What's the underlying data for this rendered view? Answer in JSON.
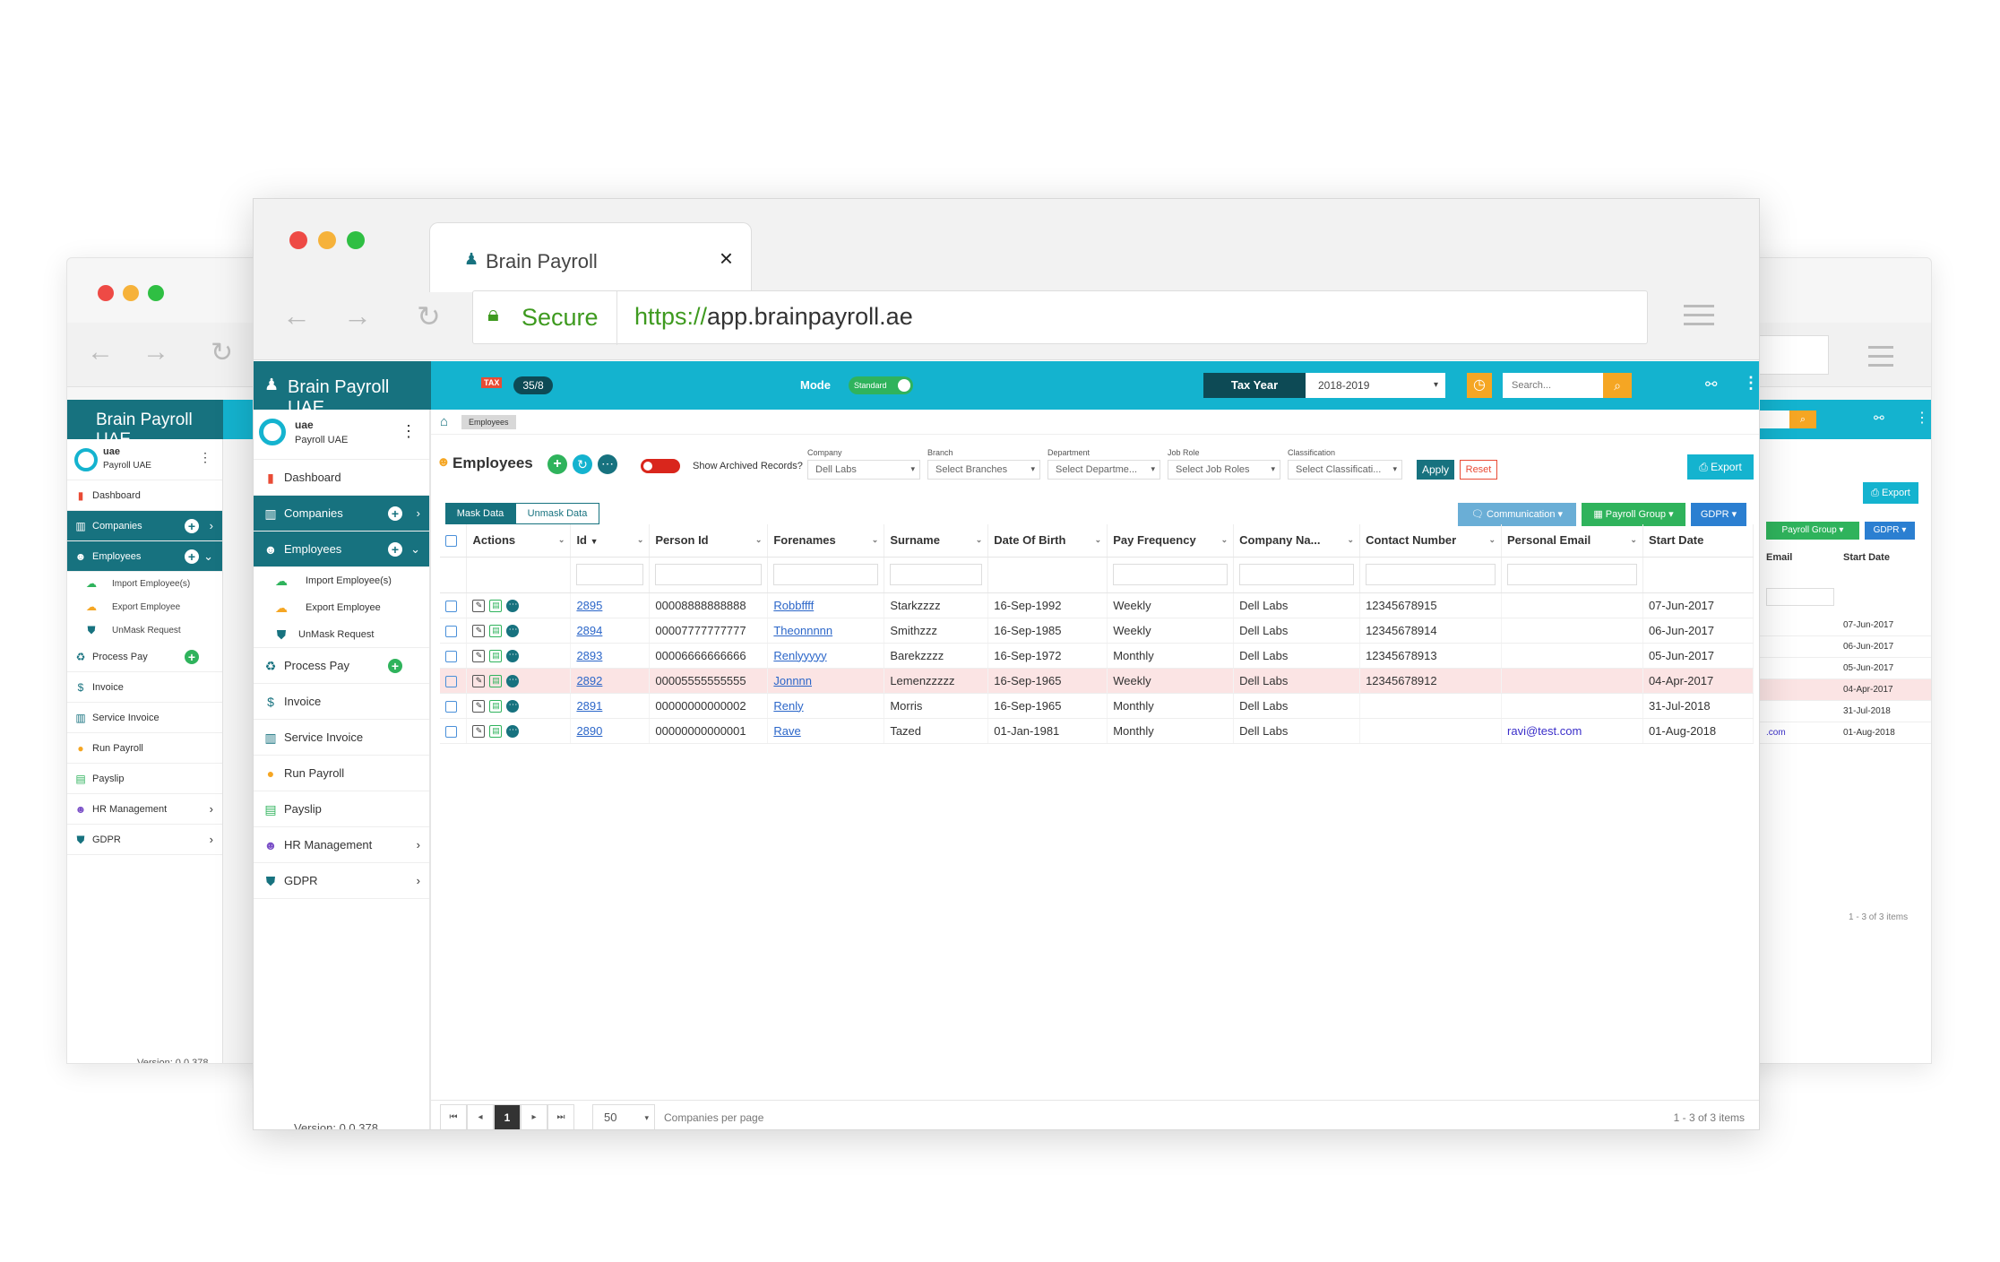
{
  "browser": {
    "tab_title": "Brain Payroll",
    "close_glyph": "×",
    "secure_label": "Secure",
    "url_scheme": "https://",
    "url_rest": "app.brainpayroll.ae"
  },
  "app": {
    "brand": "Brain Payroll UAE",
    "tax_badge": "TAX",
    "count_badge": "35/8",
    "mode_label": "Mode",
    "mode_toggle": "Standard",
    "tax_year_label": "Tax Year",
    "tax_year_value": "2018-2019",
    "search_placeholder": "Search..."
  },
  "user": {
    "name": "uae",
    "org": "Payroll UAE"
  },
  "sidebar": {
    "items": [
      {
        "label": "Dashboard"
      },
      {
        "label": "Companies"
      },
      {
        "label": "Employees"
      },
      {
        "label": "Import Employee(s)"
      },
      {
        "label": "Export Employee"
      },
      {
        "label": "UnMask Request"
      },
      {
        "label": "Process Pay"
      },
      {
        "label": "Invoice"
      },
      {
        "label": "Service Invoice"
      },
      {
        "label": "Run Payroll"
      },
      {
        "label": "Payslip"
      },
      {
        "label": "HR Management"
      },
      {
        "label": "GDPR"
      }
    ],
    "version": "Version: 0.0.378"
  },
  "page": {
    "breadcrumb": "Employees",
    "title": "Employees",
    "archived_label": "Show Archived Records?",
    "filters": [
      {
        "label": "Company",
        "value": "Dell Labs"
      },
      {
        "label": "Branch",
        "value": "Select Branches"
      },
      {
        "label": "Department",
        "value": "Select Departme..."
      },
      {
        "label": "Job Role",
        "value": "Select Job Roles"
      },
      {
        "label": "Classification",
        "value": "Select Classificati..."
      }
    ],
    "apply": "Apply",
    "reset": "Reset",
    "export": "Export",
    "mask": "Mask Data",
    "unmask": "Unmask Data",
    "communication": "Communication",
    "payroll_group": "Payroll Group",
    "gdpr": "GDPR"
  },
  "table": {
    "columns": [
      "Actions",
      "Id",
      "Person Id",
      "Forenames",
      "Surname",
      "Date Of Birth",
      "Pay Frequency",
      "Company Na...",
      "Contact Number",
      "Personal Email",
      "Start Date"
    ],
    "rows": [
      {
        "id": "2895",
        "person": "00008888888888",
        "fore": "Robbffff",
        "sur": "Starkzzzz",
        "dob": "16-Sep-1992",
        "freq": "Weekly",
        "comp": "Dell Labs",
        "phone": "12345678915",
        "email": "",
        "start": "07-Jun-2017"
      },
      {
        "id": "2894",
        "person": "00007777777777",
        "fore": "Theonnnnn",
        "sur": "Smithzzz",
        "dob": "16-Sep-1985",
        "freq": "Weekly",
        "comp": "Dell Labs",
        "phone": "12345678914",
        "email": "",
        "start": "06-Jun-2017"
      },
      {
        "id": "2893",
        "person": "00006666666666",
        "fore": "Renlyyyyy",
        "sur": "Barekzzzz",
        "dob": "16-Sep-1972",
        "freq": "Monthly",
        "comp": "Dell Labs",
        "phone": "12345678913",
        "email": "",
        "start": "05-Jun-2017"
      },
      {
        "id": "2892",
        "person": "00005555555555",
        "fore": "Jonnnn",
        "sur": "Lemenzzzzz",
        "dob": "16-Sep-1965",
        "freq": "Weekly",
        "comp": "Dell Labs",
        "phone": "12345678912",
        "email": "",
        "start": "04-Apr-2017"
      },
      {
        "id": "2891",
        "person": "00000000000002",
        "fore": "Renly",
        "sur": "Morris",
        "dob": "16-Sep-1965",
        "freq": "Monthly",
        "comp": "Dell Labs",
        "phone": "",
        "email": "",
        "start": "31-Jul-2018"
      },
      {
        "id": "2890",
        "person": "00000000000001",
        "fore": "Rave",
        "sur": "Tazed",
        "dob": "01-Jan-1981",
        "freq": "Monthly",
        "comp": "Dell Labs",
        "phone": "",
        "email": "ravi@test.com",
        "start": "01-Aug-2018"
      }
    ]
  },
  "pager": {
    "first": "⏮",
    "prev": "◂",
    "page": "1",
    "next": "▸",
    "last": "⏭",
    "page_size": "50",
    "per_page_label": "Companies per page",
    "summary": "1 - 3 of 3 items"
  },
  "right_window": {
    "columns": [
      "Email",
      "Start Date"
    ],
    "dates": [
      "07-Jun-2017",
      "06-Jun-2017",
      "05-Jun-2017",
      "04-Apr-2017",
      "31-Jul-2018",
      "01-Aug-2018"
    ],
    "email_fragment": ".com",
    "summary": "1 - 3 of 3 items"
  },
  "colors": {
    "teal": "#17727f",
    "cyan": "#14b3cf",
    "orange": "#f5a623",
    "green": "#2fb35c"
  }
}
